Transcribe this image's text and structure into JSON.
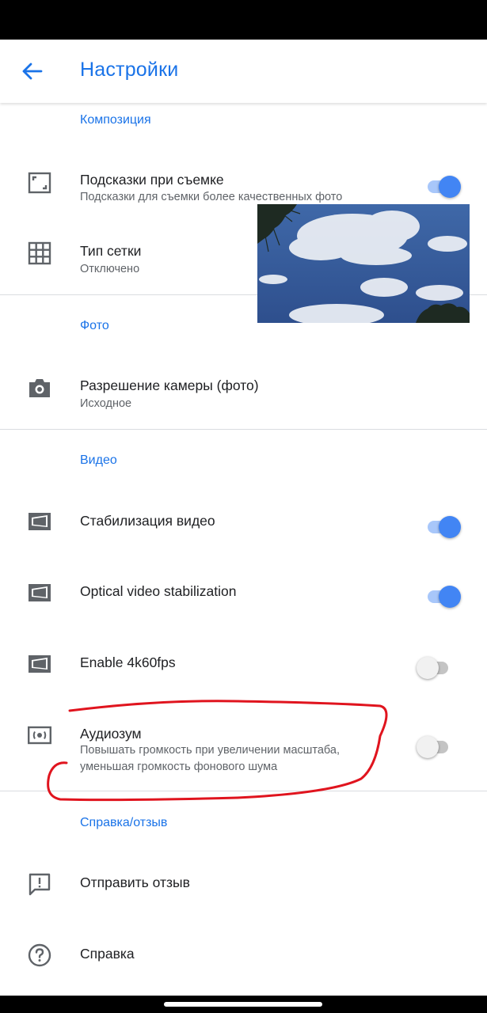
{
  "header": {
    "title": "Настройки",
    "back_icon": "arrow-back-icon"
  },
  "colors": {
    "accent": "#1a73e8",
    "toggle_on": "#4285f4",
    "annotation": "#e0141e"
  },
  "sections": {
    "composition": {
      "header": "Композиция",
      "shooting_tips": {
        "title": "Подсказки при съемке",
        "subtitle": "Подсказки для съемки более качественных фото",
        "enabled": true,
        "icon": "frame-icon"
      },
      "grid_type": {
        "title": "Тип сетки",
        "subtitle": "Отключено",
        "icon": "grid-icon"
      }
    },
    "photo": {
      "header": "Фото",
      "camera_resolution": {
        "title": "Разрешение камеры (фото)",
        "subtitle": "Исходное",
        "icon": "camera-icon"
      }
    },
    "video": {
      "header": "Видео",
      "stabilization": {
        "title": "Стабилизация видео",
        "enabled": true,
        "icon": "video-frame-icon"
      },
      "optical_stabilization": {
        "title": "Optical video stabilization",
        "enabled": true,
        "icon": "video-frame-icon"
      },
      "enable_4k60": {
        "title": "Enable 4k60fps",
        "enabled": false,
        "icon": "video-frame-icon"
      },
      "audio_zoom": {
        "title": "Аудиозум",
        "subtitle": "Повышать громкость при увеличении масштаба, уменьшая громкость фонового шума",
        "enabled": false,
        "icon": "audio-zoom-icon"
      }
    },
    "help": {
      "header": "Справка/отзыв",
      "send_feedback": {
        "title": "Отправить отзыв",
        "icon": "feedback-icon"
      },
      "help": {
        "title": "Справка",
        "icon": "help-icon"
      }
    }
  }
}
